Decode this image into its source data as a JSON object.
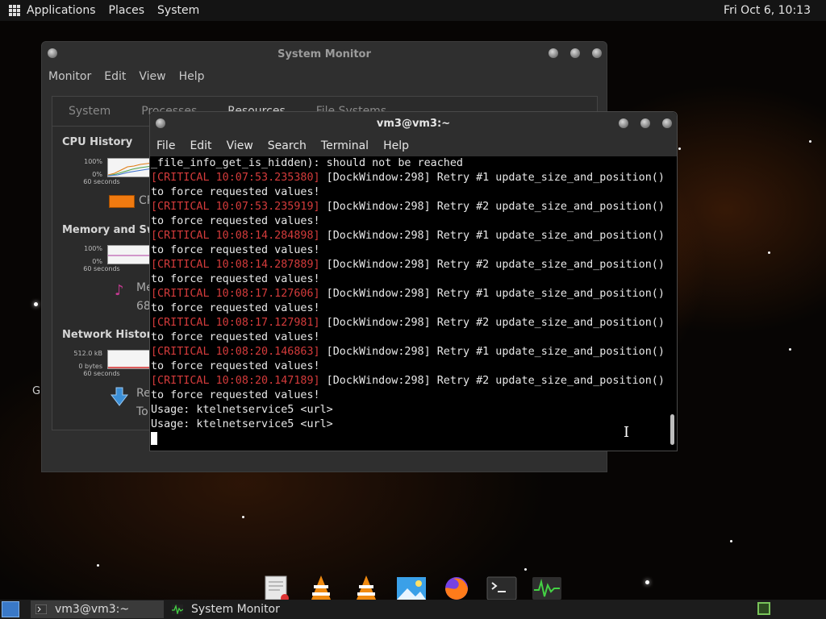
{
  "top_panel": {
    "menus": [
      "Applications",
      "Places",
      "System"
    ],
    "clock": "Fri Oct  6, 10:13"
  },
  "system_monitor": {
    "title": "System Monitor",
    "menus": [
      "Monitor",
      "Edit",
      "View",
      "Help"
    ],
    "tabs": [
      "System",
      "Processes",
      "Resources",
      "File Systems"
    ],
    "cpu": {
      "title": "CPU History",
      "top": "100%",
      "bottom": "0%",
      "span": "60 seconds",
      "legend_partial": "CP"
    },
    "memory": {
      "title": "Memory and Swap History",
      "title_visible": "Memory and Swap",
      "top": "100%",
      "bottom": "0%",
      "span": "60 seconds",
      "label_partial": "Me",
      "value_partial": "68"
    },
    "network": {
      "title": "Network History",
      "top": "512.0 kB",
      "bottom": "0 bytes",
      "span": "60 seconds",
      "receiving_partial": "Re",
      "total_partial": "To"
    },
    "left_edge_char": "G"
  },
  "terminal": {
    "title": "vm3@vm3:~",
    "menus": [
      "File",
      "Edit",
      "View",
      "Search",
      "Terminal",
      "Help"
    ],
    "lines": [
      {
        "text": "_file_info_get_is_hidden): should not be reached"
      },
      {
        "tag": "[CRITICAL 10:07:53.235380]",
        "text": " [DockWindow:298] Retry #1 update_size_and_position()"
      },
      {
        "text": "to force requested values!"
      },
      {
        "tag": "[CRITICAL 10:07:53.235919]",
        "text": " [DockWindow:298] Retry #2 update_size_and_position()"
      },
      {
        "text": "to force requested values!"
      },
      {
        "tag": "[CRITICAL 10:08:14.284898]",
        "text": " [DockWindow:298] Retry #1 update_size_and_position()"
      },
      {
        "text": "to force requested values!"
      },
      {
        "tag": "[CRITICAL 10:08:14.287889]",
        "text": " [DockWindow:298] Retry #2 update_size_and_position()"
      },
      {
        "text": "to force requested values!"
      },
      {
        "tag": "[CRITICAL 10:08:17.127606]",
        "text": " [DockWindow:298] Retry #1 update_size_and_position()"
      },
      {
        "text": "to force requested values!"
      },
      {
        "tag": "[CRITICAL 10:08:17.127981]",
        "text": " [DockWindow:298] Retry #2 update_size_and_position()"
      },
      {
        "text": "to force requested values!"
      },
      {
        "tag": "[CRITICAL 10:08:20.146863]",
        "text": " [DockWindow:298] Retry #1 update_size_and_position()"
      },
      {
        "text": "to force requested values!"
      },
      {
        "tag": "[CRITICAL 10:08:20.147189]",
        "text": " [DockWindow:298] Retry #2 update_size_and_position()"
      },
      {
        "text": "to force requested values!"
      },
      {
        "text": "Usage: ktelnetservice5 <url>"
      },
      {
        "text": "Usage: ktelnetservice5 <url>"
      }
    ]
  },
  "dock": {
    "icons": [
      "text-editor-icon",
      "vlc-icon",
      "vlc-icon",
      "image-viewer-icon",
      "firefox-icon",
      "terminal-icon",
      "system-monitor-icon"
    ]
  },
  "bottom_panel": {
    "tasks": [
      {
        "label": "vm3@vm3:~",
        "icon": "terminal-icon"
      },
      {
        "label": "System Monitor",
        "icon": "system-monitor-icon"
      }
    ]
  },
  "colors": {
    "critical": "#d43b3b",
    "cpu_swatch": "#f07a10",
    "panel": "#141414"
  }
}
